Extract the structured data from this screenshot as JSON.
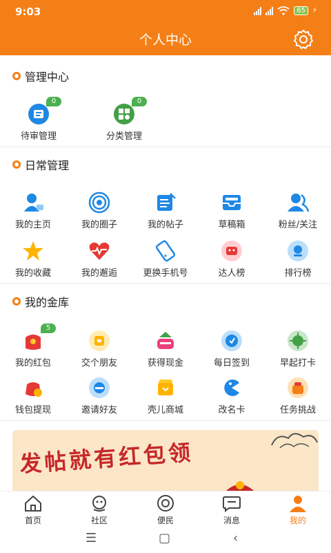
{
  "status": {
    "time": "9:03",
    "battery": "65"
  },
  "header": {
    "title": "个人中心"
  },
  "sections": {
    "manage": {
      "title": "管理中心",
      "items": [
        {
          "label": "待审管理",
          "badge": "0",
          "icon": "pending-review-icon"
        },
        {
          "label": "分类管理",
          "badge": "0",
          "icon": "category-icon"
        }
      ]
    },
    "daily": {
      "title": "日常管理",
      "items": [
        {
          "label": "我的主页",
          "icon": "user-home-icon"
        },
        {
          "label": "我的圈子",
          "icon": "circle-icon"
        },
        {
          "label": "我的帖子",
          "icon": "post-icon"
        },
        {
          "label": "草稿箱",
          "icon": "drafts-icon"
        },
        {
          "label": "粉丝/关注",
          "icon": "followers-icon"
        },
        {
          "label": "我的收藏",
          "icon": "star-icon"
        },
        {
          "label": "我的邂逅",
          "icon": "heart-icon"
        },
        {
          "label": "更换手机号",
          "icon": "phone-icon"
        },
        {
          "label": "达人榜",
          "icon": "expert-icon"
        },
        {
          "label": "排行榜",
          "icon": "ranking-icon"
        }
      ]
    },
    "wallet": {
      "title": "我的金库",
      "items": [
        {
          "label": "我的红包",
          "badge": "5",
          "icon": "red-packet-icon"
        },
        {
          "label": "交个朋友",
          "icon": "friend-icon"
        },
        {
          "label": "获得现金",
          "icon": "cash-icon"
        },
        {
          "label": "每日签到",
          "icon": "checkin-icon"
        },
        {
          "label": "早起打卡",
          "icon": "early-clock-icon"
        },
        {
          "label": "钱包提现",
          "icon": "withdraw-icon"
        },
        {
          "label": "邀请好友",
          "icon": "invite-icon"
        },
        {
          "label": "壳儿商城",
          "icon": "mall-icon"
        },
        {
          "label": "改名卡",
          "icon": "rename-icon"
        },
        {
          "label": "任务挑战",
          "icon": "task-icon"
        }
      ]
    }
  },
  "banner": {
    "text": "发帖就有红包领"
  },
  "tabs": [
    {
      "label": "首页",
      "icon": "home-icon"
    },
    {
      "label": "社区",
      "icon": "community-icon"
    },
    {
      "label": "便民",
      "icon": "service-icon"
    },
    {
      "label": "消息",
      "icon": "message-icon"
    },
    {
      "label": "我的",
      "icon": "profile-icon"
    }
  ],
  "colors": {
    "accent": "#f57f17",
    "badge": "#4caf50",
    "red": "#e53935",
    "blue": "#1e88e5"
  }
}
